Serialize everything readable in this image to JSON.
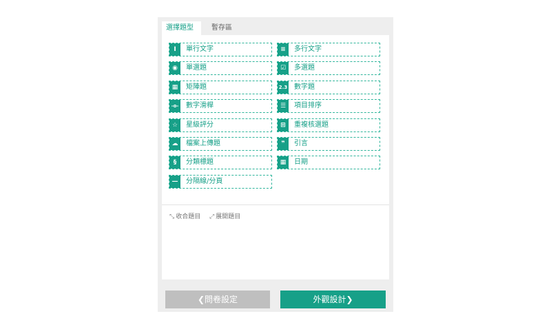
{
  "tabs": {
    "active": "選擇題型",
    "inactive": "暫存區"
  },
  "question_types": [
    {
      "label": "單行文字",
      "icon": "single-line-text-icon",
      "glyph": "I"
    },
    {
      "label": "多行文字",
      "icon": "multi-line-text-icon",
      "glyph": "≡"
    },
    {
      "label": "單選題",
      "icon": "radio-icon",
      "glyph": "◉"
    },
    {
      "label": "多選題",
      "icon": "checkbox-icon",
      "glyph": "☑"
    },
    {
      "label": "矩陣題",
      "icon": "matrix-icon",
      "glyph": "▦"
    },
    {
      "label": "數字題",
      "icon": "number-icon",
      "glyph": "2.3"
    },
    {
      "label": "數字滑桿",
      "icon": "slider-icon",
      "glyph": "-o-"
    },
    {
      "label": "項目排序",
      "icon": "sort-list-icon",
      "glyph": "☰"
    },
    {
      "label": "星級評分",
      "icon": "star-icon",
      "glyph": "☆"
    },
    {
      "label": "重複核選題",
      "icon": "repeat-check-icon",
      "glyph": "⊞"
    },
    {
      "label": "檔案上傳題",
      "icon": "cloud-upload-icon",
      "glyph": "☁"
    },
    {
      "label": "引言",
      "icon": "quote-icon",
      "glyph": "❞"
    },
    {
      "label": "分類標題",
      "icon": "section-icon",
      "glyph": "§"
    },
    {
      "label": "日期",
      "icon": "calendar-icon",
      "glyph": "▦"
    },
    {
      "label": "分隔線/分頁",
      "icon": "divider-icon",
      "glyph": "—"
    }
  ],
  "controls": {
    "collapse": "收合題目",
    "expand": "展開題目"
  },
  "buttons": {
    "prev": "問卷設定",
    "next": "外觀設計"
  },
  "colors": {
    "accent": "#17a088",
    "disabled": "#bfbfbf",
    "panel": "#eeeeee"
  }
}
